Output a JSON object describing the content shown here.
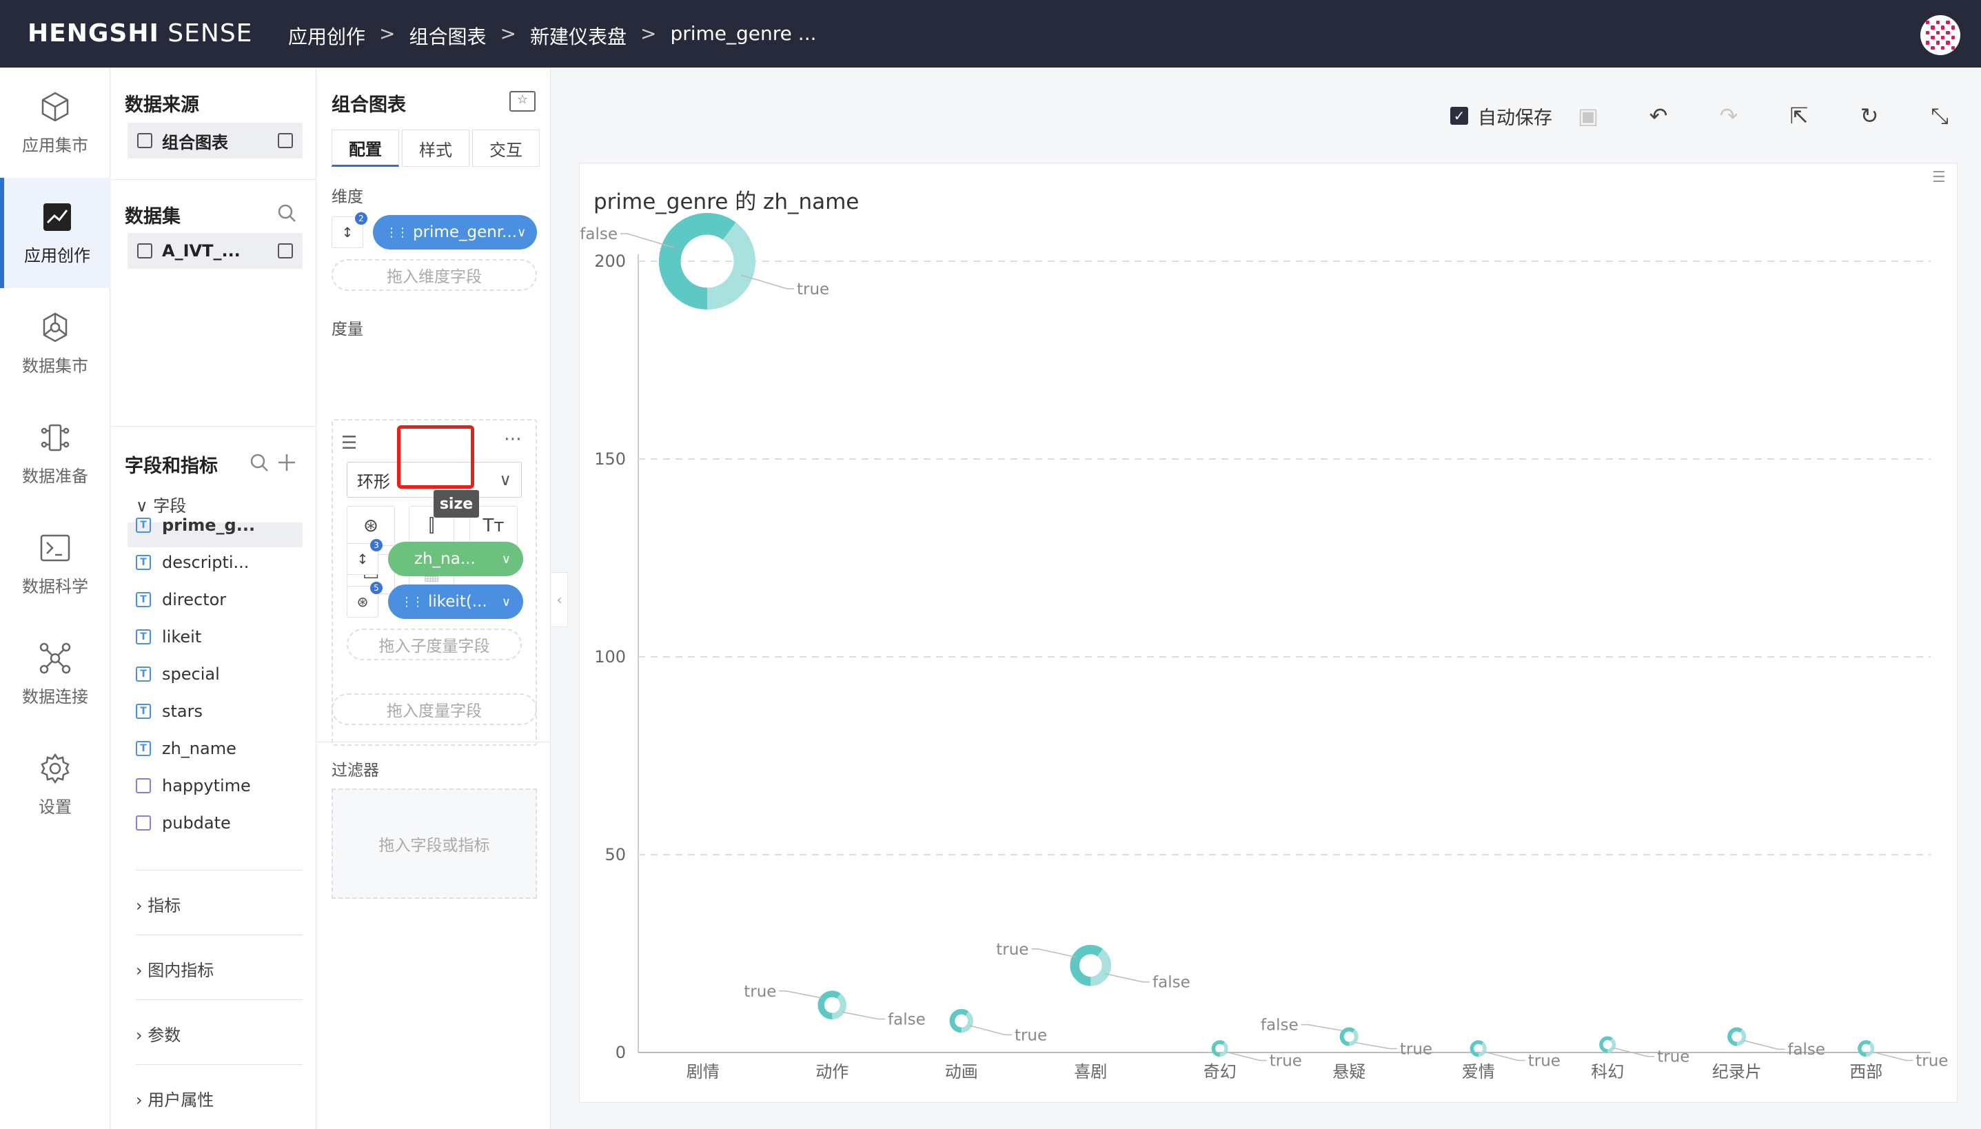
{
  "header": {
    "brand_bold": "HENGSHI",
    "brand_light": " SENSE",
    "breadcrumbs": [
      "应用创作",
      "组合图表",
      "新建仪表盘",
      "prime_genre ..."
    ],
    "separator": ">"
  },
  "nav": {
    "items": [
      {
        "label": "应用集市",
        "icon": "cube-icon"
      },
      {
        "label": "应用创作",
        "icon": "chart-create-icon"
      },
      {
        "label": "数据集市",
        "icon": "hexagon-network-icon"
      },
      {
        "label": "数据准备",
        "icon": "data-prep-icon"
      },
      {
        "label": "数据科学",
        "icon": "terminal-icon"
      },
      {
        "label": "数据连接",
        "icon": "connection-icon"
      },
      {
        "label": "设置",
        "icon": "gear-icon"
      }
    ]
  },
  "datasource": {
    "title": "数据来源",
    "source_name": "组合图表",
    "dataset_title": "数据集",
    "dataset_name": "A_IVT_...",
    "fields_title": "字段和指标",
    "fields_group": "字段",
    "fields": [
      {
        "name": "prime_g...",
        "type": "text"
      },
      {
        "name": "descripti...",
        "type": "text"
      },
      {
        "name": "director",
        "type": "text"
      },
      {
        "name": "likeit",
        "type": "text"
      },
      {
        "name": "special",
        "type": "text"
      },
      {
        "name": "stars",
        "type": "text"
      },
      {
        "name": "zh_name",
        "type": "text"
      },
      {
        "name": "happytime",
        "type": "date"
      },
      {
        "name": "pubdate",
        "type": "date"
      }
    ],
    "groups": [
      "指标",
      "图内指标",
      "参数",
      "用户属性"
    ]
  },
  "config": {
    "title": "组合图表",
    "tabs": [
      "配置",
      "样式",
      "交互"
    ],
    "dimension_label": "维度",
    "dimension_pill": "prime_genr...",
    "dimension_drop": "拖入维度字段",
    "measure_label": "度量",
    "chart_type": "环形",
    "tooltip": "size",
    "measure_pill_1": "zh_na...",
    "measure_pill_2": "likeit(...",
    "sub_measure_drop": "拖入子度量字段",
    "measure_drop": "拖入度量字段",
    "filter_label": "过滤器",
    "filter_drop": "拖入字段或指标",
    "colors": {
      "blue": "#4a8fe0",
      "green": "#6cc17e",
      "highlight": "#e8201a"
    }
  },
  "toolbar": {
    "autosave_label": "自动保存",
    "icons": [
      "save-icon",
      "undo-icon",
      "redo-icon",
      "share-icon",
      "refresh-icon",
      "collapse-icon"
    ]
  },
  "chart_data": {
    "type": "scatter",
    "title": "prime_genre 的 zh_name",
    "categories": [
      "剧情",
      "动作",
      "动画",
      "喜剧",
      "奇幻",
      "悬疑",
      "爱情",
      "科幻",
      "纪录片",
      "西部"
    ],
    "values": [
      200,
      12,
      8,
      22,
      1,
      4,
      1,
      2,
      4,
      1
    ],
    "yticks": [
      0,
      50,
      100,
      150,
      200
    ],
    "ylim": [
      0,
      200
    ],
    "marker": "donut",
    "donut_labels": [
      [
        "false",
        "true"
      ],
      [
        "true",
        "false"
      ],
      [
        "true"
      ],
      [
        "true",
        "false"
      ],
      [
        "true"
      ],
      [
        "false",
        "true"
      ],
      [
        "true"
      ],
      [
        "true"
      ],
      [
        "false"
      ],
      [
        "true"
      ]
    ],
    "colors": [
      "#5ec8c4",
      "#a9e1df"
    ],
    "grid": true
  }
}
